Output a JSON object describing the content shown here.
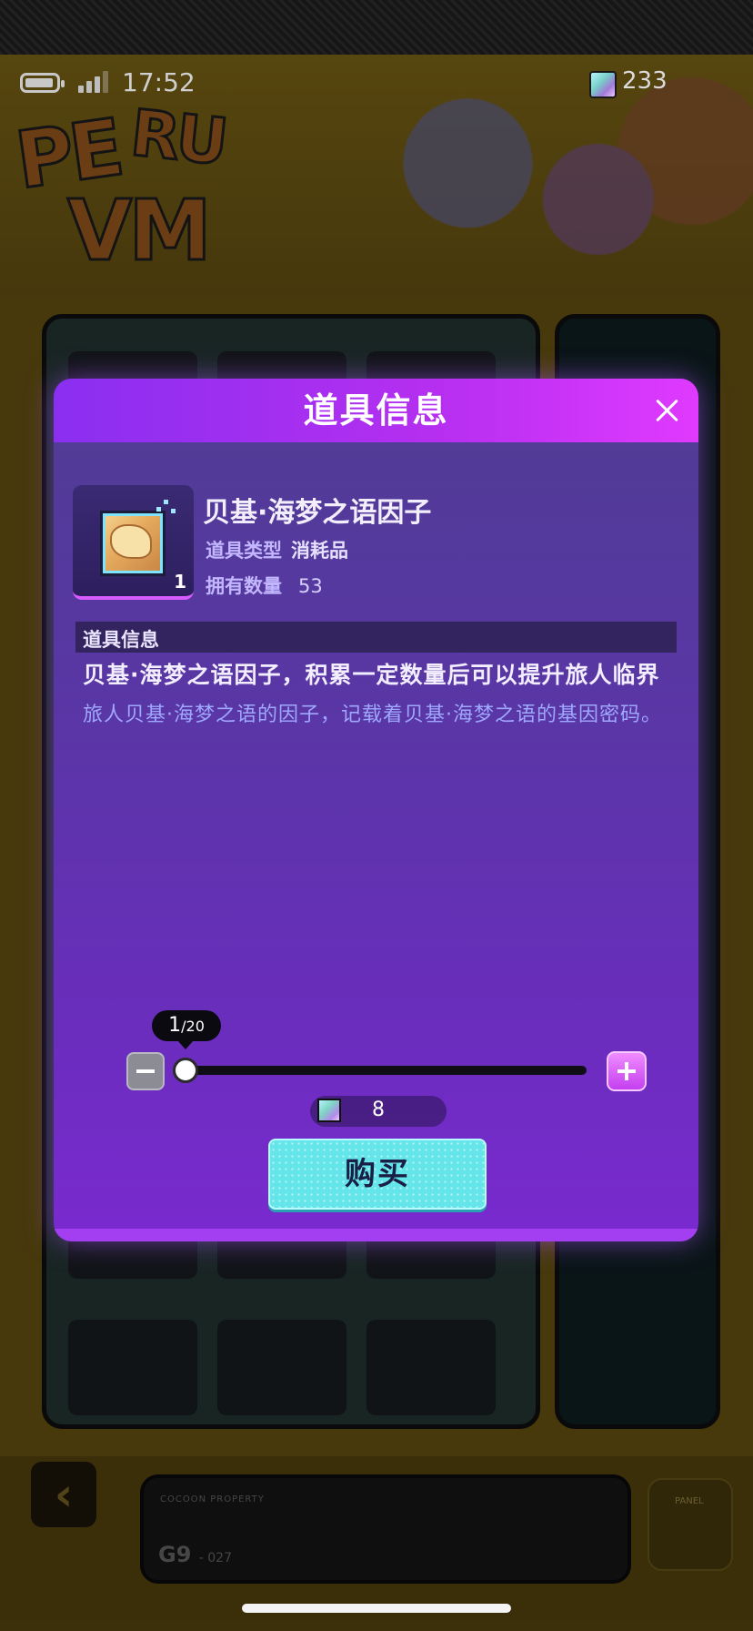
{
  "status_bar": {
    "time": "17:52",
    "currency_count": "233",
    "icons": [
      "battery-icon",
      "signal-icon",
      "gem-icon"
    ]
  },
  "background": {
    "logo_text": "PERU VM",
    "property_label": "COCOON PROPERTY",
    "property_code": "G9",
    "property_code_suffix": "- 027",
    "panel_tag": "PANEL"
  },
  "modal": {
    "title": "道具信息",
    "item": {
      "name": "贝基·海梦之语因子",
      "type_label": "道具类型",
      "type_value": "消耗品",
      "owned_label": "拥有数量",
      "owned_value": "53",
      "thumb_count": "1"
    },
    "section_title": "道具信息",
    "description_main": "贝基·海梦之语因子，积累一定数量后可以提升旅人临界",
    "description_sub": "旅人贝基·海梦之语的因子，记载着贝基·海梦之语的基因密码。",
    "quantity": {
      "current": "1",
      "max": "/20"
    },
    "price": "8",
    "buy_label": "购买"
  },
  "colors": {
    "modal_header": "#b62ff0",
    "modal_body": "#5a36a6",
    "buy_button": "#63e5ea",
    "plus_button": "#c43ff0"
  }
}
